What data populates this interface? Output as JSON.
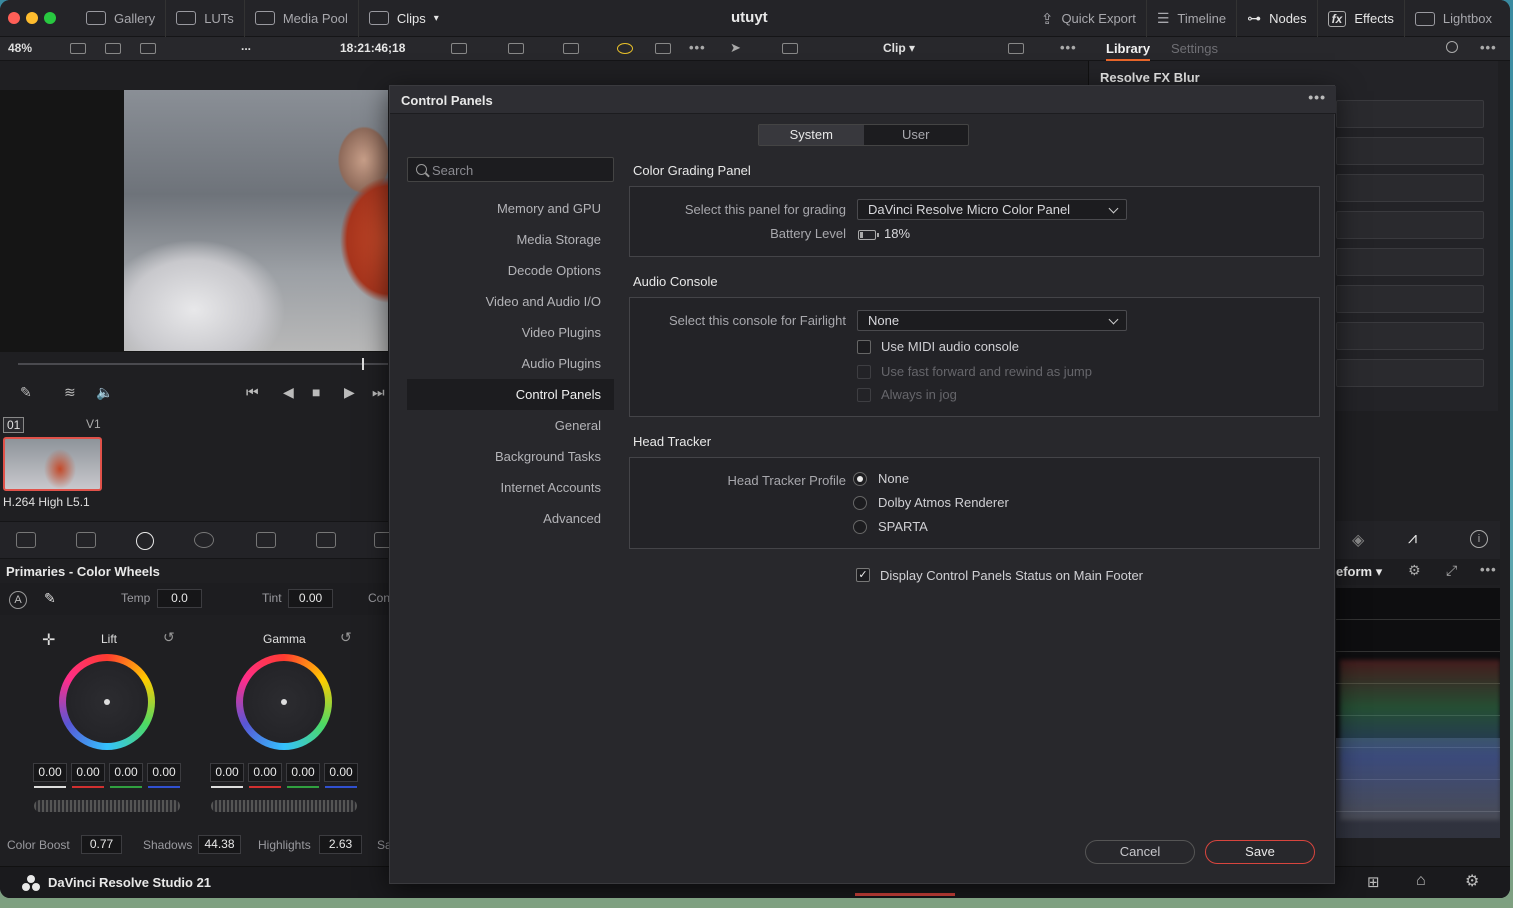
{
  "topbar": {
    "gallery": "Gallery",
    "luts": "LUTs",
    "media_pool": "Media Pool",
    "clips": "Clips",
    "project_title": "utuyt",
    "quick_export": "Quick Export",
    "timeline": "Timeline",
    "nodes": "Nodes",
    "effects": "Effects",
    "lightbox": "Lightbox"
  },
  "toolbar2": {
    "zoom": "48%",
    "dots": "...",
    "timecode": "18:21:46;18",
    "clip_label": "Clip",
    "library_tab": "Library",
    "settings_tab": "Settings"
  },
  "effects_panel": {
    "title": "Resolve FX Blur"
  },
  "clips_strip": {
    "clip_number": "01",
    "track": "V1",
    "codec": "H.264 High L5.1"
  },
  "primaries": {
    "title": "Primaries - Color Wheels",
    "temp_label": "Temp",
    "temp_value": "0.0",
    "tint_label": "Tint",
    "tint_value": "0.00",
    "contrast_label": "Con",
    "wheels": [
      {
        "name": "Lift",
        "values": [
          "0.00",
          "0.00",
          "0.00",
          "0.00"
        ]
      },
      {
        "name": "Gamma",
        "values": [
          "0.00",
          "0.00",
          "0.00",
          "0.00"
        ]
      }
    ],
    "color_boost_label": "Color Boost",
    "color_boost_value": "0.77",
    "shadows_label": "Shadows",
    "shadows_value": "44.38",
    "highlights_label": "Highlights",
    "highlights_value": "2.63",
    "sat_label": "Sa"
  },
  "scope": {
    "title": "eform"
  },
  "status": {
    "app_name": "DaVinci Resolve Studio 21"
  },
  "dialog": {
    "title": "Control Panels",
    "tabs": [
      "System",
      "User"
    ],
    "search_placeholder": "Search",
    "nav": [
      "Memory and GPU",
      "Media Storage",
      "Decode Options",
      "Video and Audio I/O",
      "Video Plugins",
      "Audio Plugins",
      "Control Panels",
      "General",
      "Background Tasks",
      "Internet Accounts",
      "Advanced"
    ],
    "color_grading": {
      "title": "Color Grading Panel",
      "select_label": "Select this panel for grading",
      "select_value": "DaVinci Resolve Micro Color Panel",
      "battery_label": "Battery Level",
      "battery_value": "18%"
    },
    "audio_console": {
      "title": "Audio Console",
      "select_label": "Select this console for Fairlight",
      "select_value": "None",
      "use_midi": "Use MIDI audio console",
      "fast_forward": "Use fast forward and rewind as jump",
      "always_jog": "Always in jog"
    },
    "head_tracker": {
      "title": "Head Tracker",
      "profile_label": "Head Tracker Profile",
      "options": [
        "None",
        "Dolby Atmos Renderer",
        "SPARTA"
      ],
      "selected": "None"
    },
    "footer_checkbox": "Display Control Panels Status on Main Footer",
    "cancel": "Cancel",
    "save": "Save"
  },
  "colors": {
    "accent": "#e8662a",
    "save_border": "#d8453e",
    "clip_border": "#e0524a"
  }
}
